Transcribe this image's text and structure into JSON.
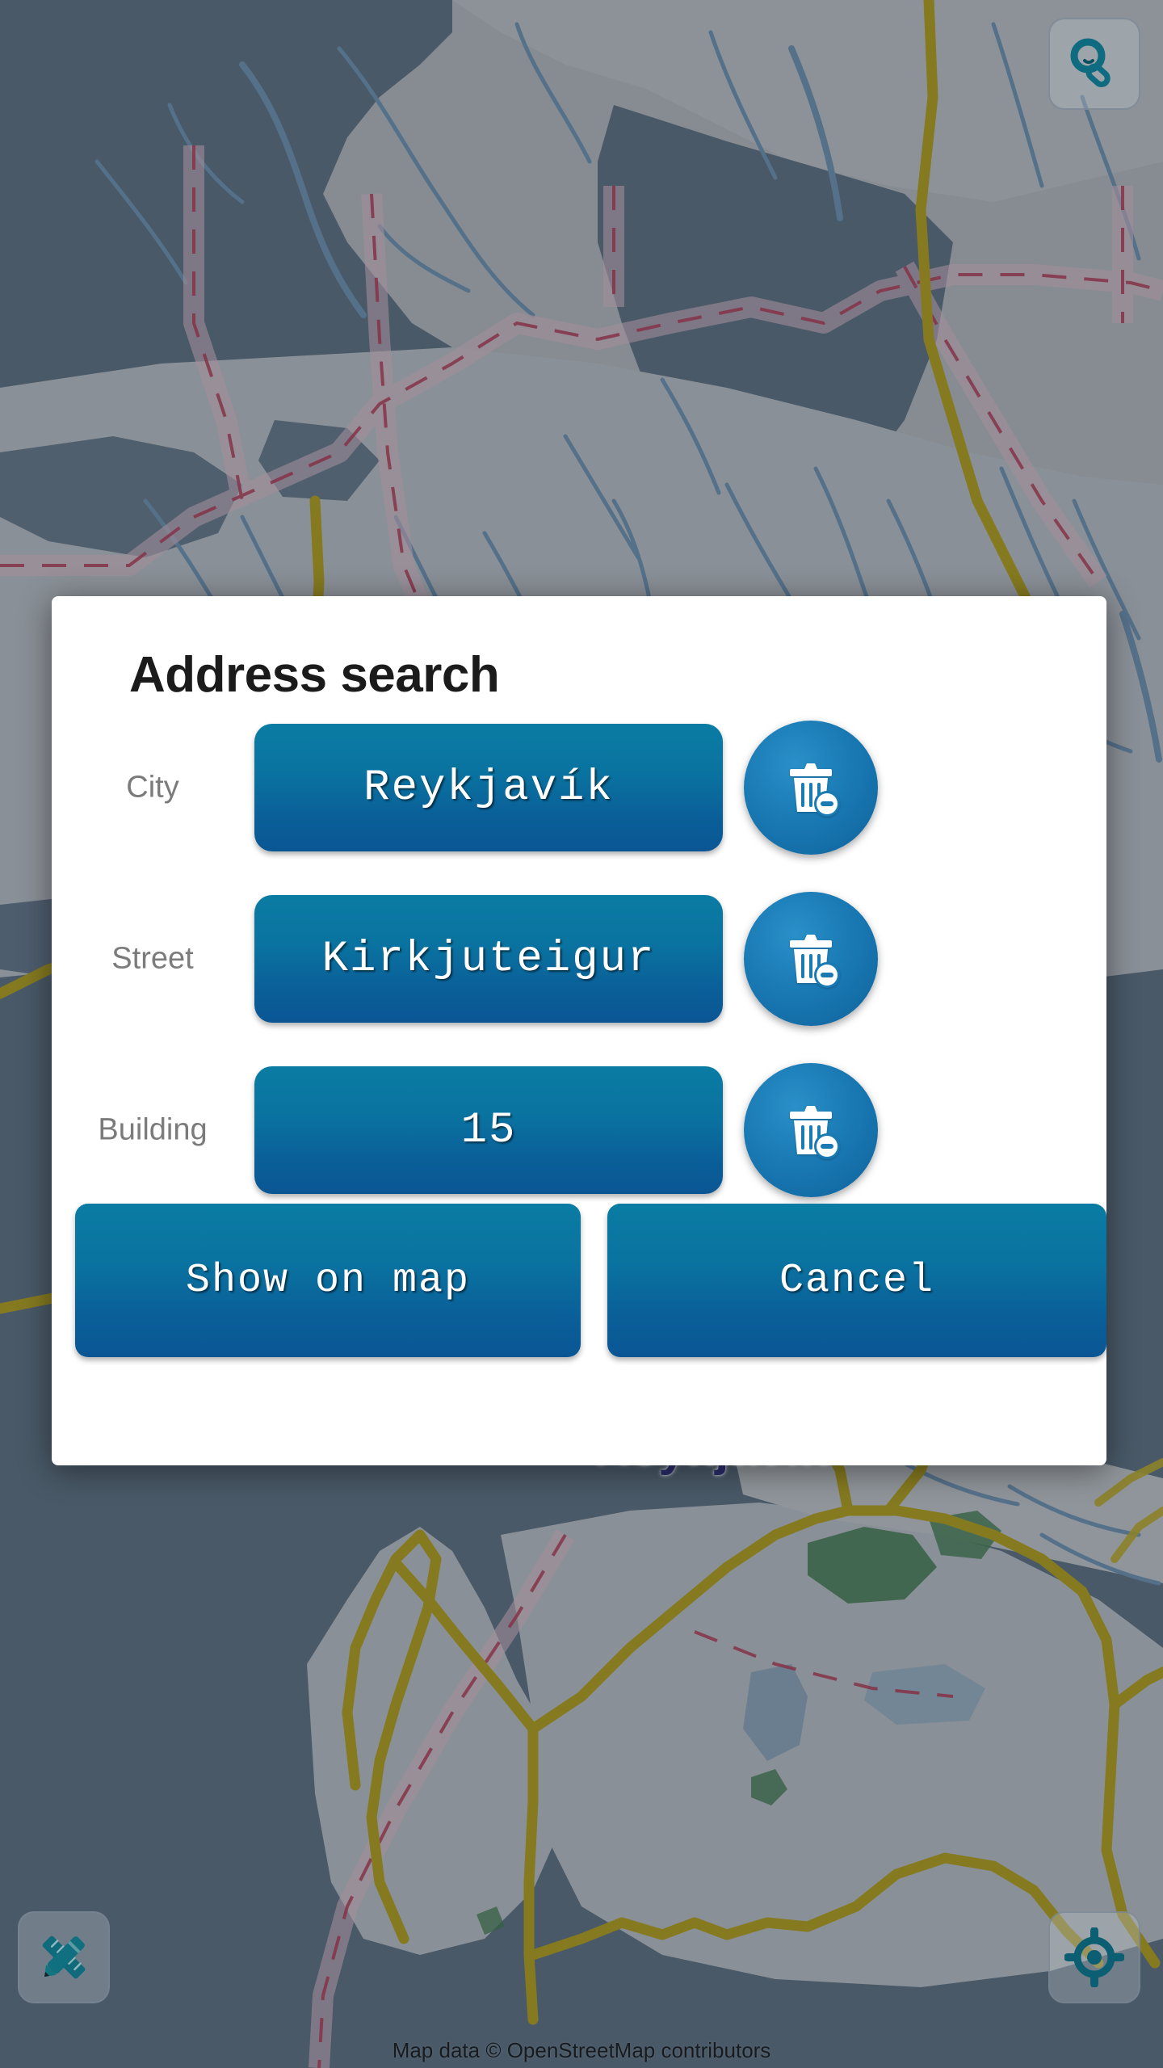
{
  "map": {
    "labels": [
      {
        "name": "reykjavik",
        "text": "Reykjavík"
      }
    ],
    "attribution": "Map data © OpenStreetMap contributors",
    "tools": [
      {
        "id": "search",
        "icon": "magnifier-icon",
        "title": "Address search"
      },
      {
        "id": "measure",
        "icon": "ruler-pencil-icon",
        "title": "Measure"
      },
      {
        "id": "locate",
        "icon": "crosshair-icon",
        "title": "My location"
      }
    ],
    "colors": {
      "water": "#5d6f80",
      "land": "#b9bcc1",
      "road_primary": "#b8a214",
      "river": "#6f93b5",
      "boundary": "#a8486a",
      "forest": "#3f7a4b",
      "label": "#2b2c6b",
      "dim": "rgba(36,46,56,0.34)"
    }
  },
  "dialog": {
    "title": "Address search",
    "fields": [
      {
        "id": "city",
        "label": "City",
        "value": "Reykjavík",
        "clear_icon": "trash-minus-icon"
      },
      {
        "id": "street",
        "label": "Street",
        "value": "Kirkjuteigur",
        "clear_icon": "trash-minus-icon"
      },
      {
        "id": "building",
        "label": "Building",
        "value": "15",
        "clear_icon": "trash-minus-icon"
      }
    ],
    "actions": {
      "show_on_map": "Show on map",
      "cancel": "Cancel"
    },
    "colors": {
      "button_top": "#0a7ca3",
      "button_bottom": "#0a5694",
      "clear_button": "#1a7ab4",
      "surface": "#ffffff",
      "label_text": "#7b7b7b",
      "title_text": "#1b1b1b"
    }
  }
}
